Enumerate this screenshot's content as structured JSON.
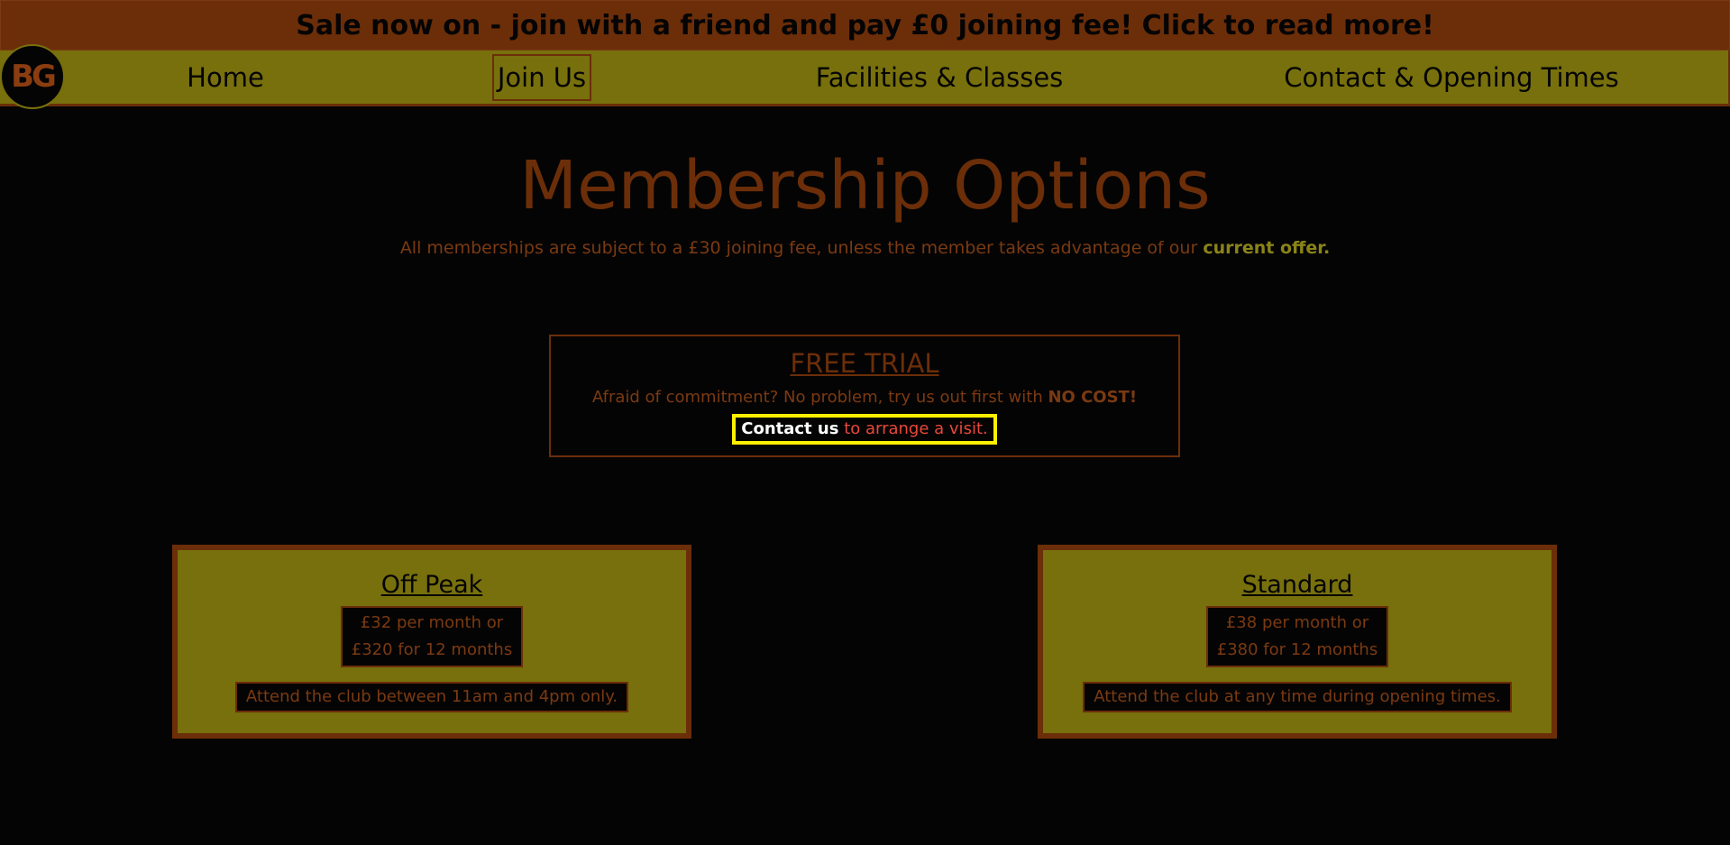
{
  "banner": {
    "text": "Sale now on - join with a friend and pay £0 joining fee! Click to read more!"
  },
  "logo": {
    "text": "BG"
  },
  "nav": {
    "items": [
      {
        "label": "Home"
      },
      {
        "label": "Join Us"
      },
      {
        "label": "Facilities & Classes"
      },
      {
        "label": "Contact & Opening Times"
      }
    ]
  },
  "main": {
    "title": "Membership Options",
    "subtitle_text": "All memberships are subject to a £30 joining fee, unless the member takes advantage of our ",
    "subtitle_link": "current offer."
  },
  "trial": {
    "title": "FREE TRIAL",
    "text": "Afraid of commitment? No problem, try us out first with ",
    "text_bold": "NO COST!",
    "cta_link": "Contact us",
    "cta_text": " to arrange a visit."
  },
  "plans": [
    {
      "name": "Off Peak",
      "price_line1": "£32 per month or",
      "price_line2": "£320 for 12 months",
      "note": "Attend the club between 11am and 4pm only."
    },
    {
      "name": "Standard",
      "price_line1": "£38 per month or",
      "price_line2": "£380 for 12 months",
      "note": "Attend the club at any time during opening times."
    }
  ],
  "colors": {
    "brown": "#6b2e09",
    "olive": "#77700d",
    "background": "#050404",
    "highlight_yellow": "#ffef00"
  }
}
